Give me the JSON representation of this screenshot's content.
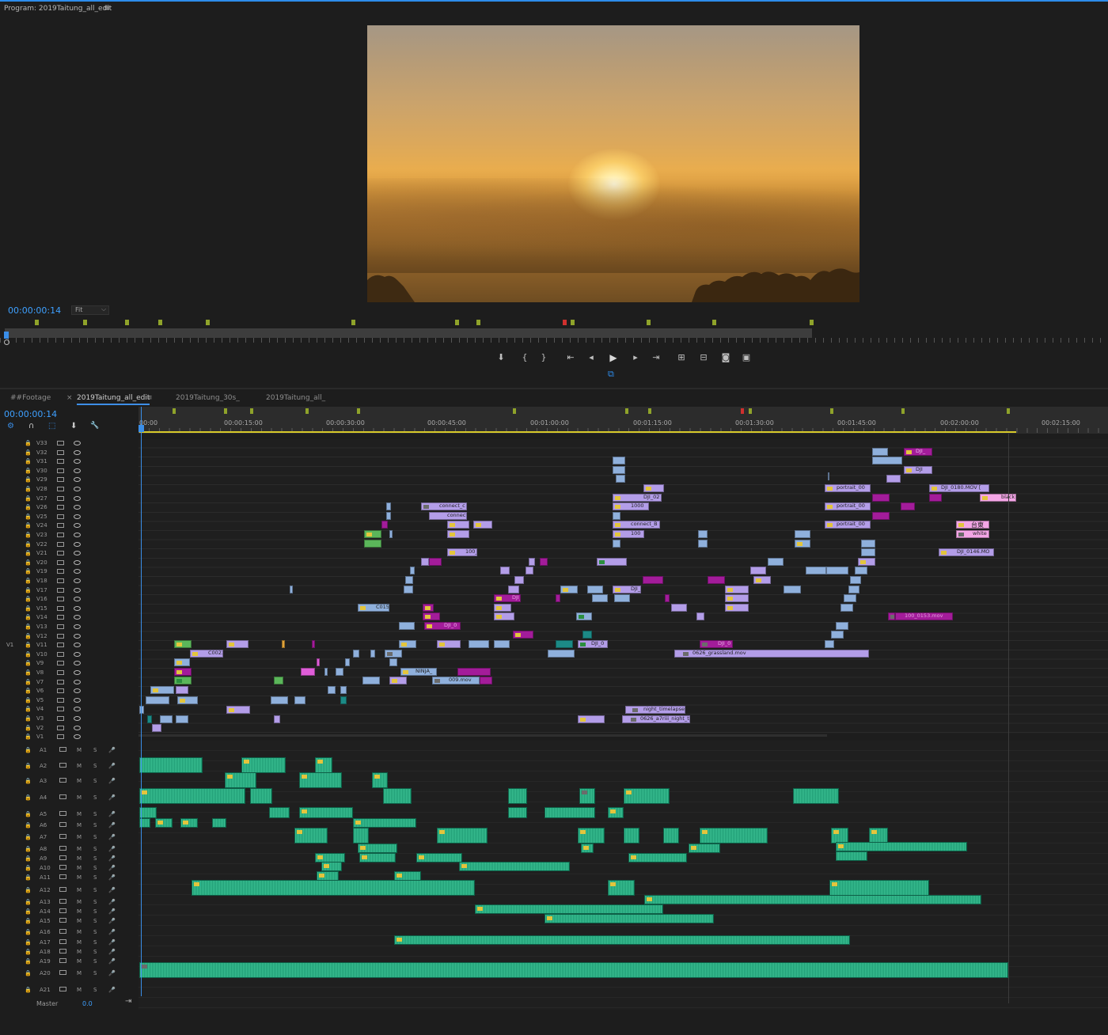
{
  "program": {
    "title": "Program: 2019Taitung_all_edit",
    "menu_icon": "≡",
    "timecode": "00:00:00:14",
    "zoom": "Fit",
    "chevron": "⌵",
    "settings_icon": "⧉"
  },
  "transport": {
    "marker": "⬇",
    "mark_in": "{",
    "mark_out": "}",
    "go_to_in": "⇤",
    "step_back": "◂",
    "play": "▶",
    "step_forward": "▸",
    "go_to_out": "⇥",
    "insert": "⊞",
    "overwrite": "⊟",
    "export_frame": "◙",
    "compare": "▣"
  },
  "tabs": [
    {
      "label": "##Footage",
      "active": false
    },
    {
      "label": "2019Taitung_all_edit",
      "active": true,
      "close": "×",
      "menu": "≡"
    },
    {
      "label": "2019Taitung_30s_",
      "active": false
    },
    {
      "label": "2019Taitung_all_",
      "active": false
    }
  ],
  "timeline": {
    "timecode": "00:00:00:14",
    "ruler_labels": [
      "00:00",
      "00:00:15:00",
      "00:00:30:00",
      "00:00:45:00",
      "00:01:00:00",
      "00:01:15:00",
      "00:01:30:00",
      "00:01:45:00",
      "00:02:00:00",
      "00:02:15:00"
    ],
    "tools": [
      "⚙",
      "∩",
      "⬚",
      "⬇",
      "🔧"
    ],
    "v1_source": "V1",
    "master_label": "Master",
    "master_value": "0.0",
    "master_end_icon": "⇥"
  },
  "video_tracks": [
    "V33",
    "V32",
    "V31",
    "V30",
    "V29",
    "V28",
    "V27",
    "V26",
    "V25",
    "V24",
    "V23",
    "V22",
    "V21",
    "V20",
    "V19",
    "V18",
    "V17",
    "V16",
    "V15",
    "V14",
    "V13",
    "V12",
    "V11",
    "V10",
    "V9",
    "V8",
    "V7",
    "V6",
    "V5",
    "V4",
    "V3",
    "V2",
    "V1"
  ],
  "audio_tracks": [
    "A1",
    "A2",
    "A3",
    "A4",
    "A5",
    "A6",
    "A7",
    "A8",
    "A9",
    "A10",
    "A11",
    "A12",
    "A13",
    "A14",
    "A15",
    "A16",
    "A17",
    "A18",
    "A19",
    "A20",
    "A21"
  ],
  "audio_labels": {
    "mute": "M",
    "solo": "S",
    "lock": "🔒",
    "mic": "🎤"
  },
  "clip_names": {
    "c1": "connect_c",
    "c2": "connect",
    "c3": "100_",
    "c4": "C015",
    "c5": "C0022",
    "c6": "NINJA_",
    "c7": "009.mov",
    "c8": "DJI_02",
    "c9": "1000",
    "c10": "connect_B",
    "c11": "100",
    "c12": "DJI_",
    "c13": "night_timelapse",
    "c14": "0626_a7riii_night_ti",
    "c15": "0626_grassland.mov",
    "c16": "DJI_0",
    "c17": "portrait_00",
    "c18": "portrait_00",
    "c19": "portrait_00",
    "c20": "DJI",
    "c21": "DJI",
    "c22": "DJI_0180.MOV [",
    "c23": "black",
    "c24": "台東",
    "c25": "white",
    "c26": "DJI_0146.MO",
    "c27": "100_0153.mov",
    "c28": "DJI_",
    "c29": "DJI_0",
    "c30": "DJI_0"
  }
}
